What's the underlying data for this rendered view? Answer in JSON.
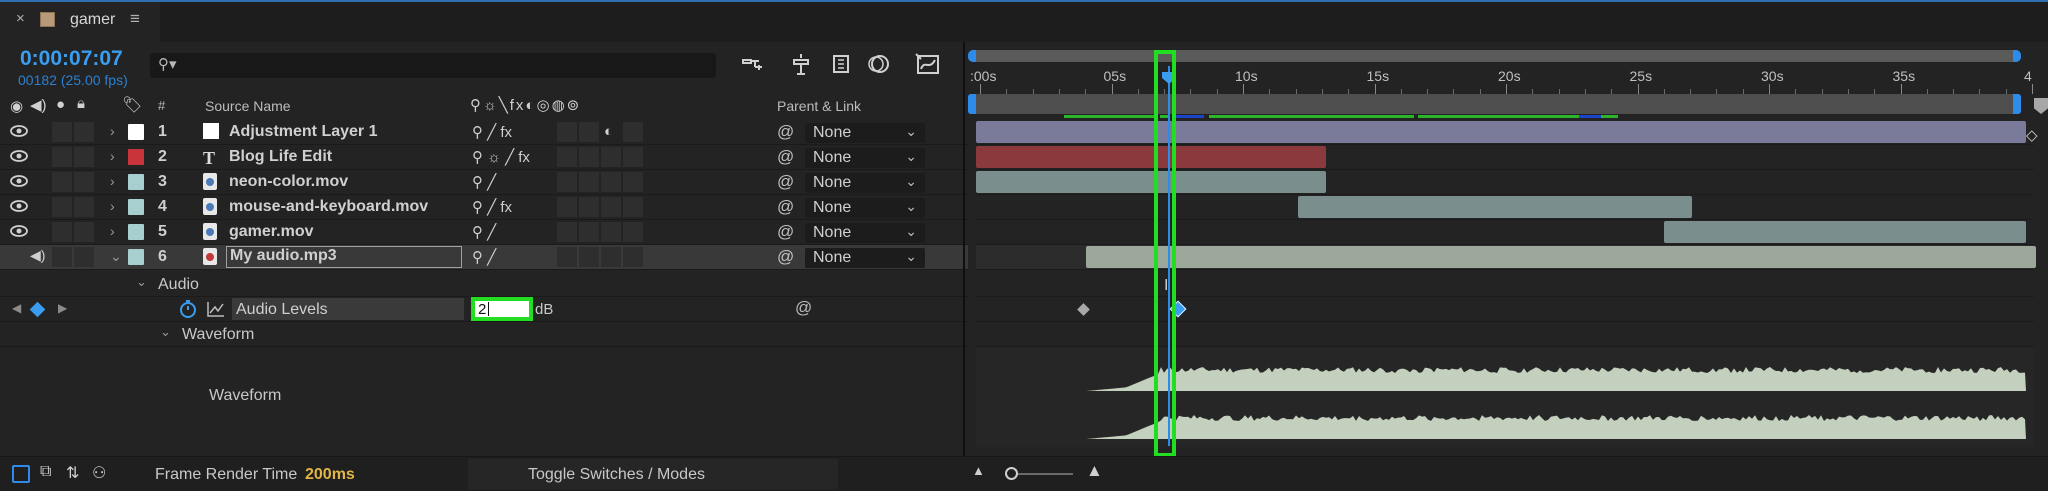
{
  "tab": {
    "title": "gamer"
  },
  "timecode": {
    "main": "0:00:07:07",
    "sub": "00182 (25.00 fps)"
  },
  "search": {
    "placeholder": ""
  },
  "columns": {
    "num": "#",
    "source_name": "Source Name",
    "parent_link": "Parent & Link"
  },
  "layers": [
    {
      "num": "1",
      "name": "Adjustment Layer 1",
      "label_color": "#ffffff",
      "type": "adjustment",
      "parent": "None",
      "switches": "⚲ ╱ fx"
    },
    {
      "num": "2",
      "name": "Blog Life Edit",
      "label_color": "#c8343a",
      "type": "text",
      "parent": "None",
      "switches": "⚲ ☼ ╱ fx"
    },
    {
      "num": "3",
      "name": "neon-color.mov",
      "label_color": "#a8cfcf",
      "type": "footage",
      "parent": "None",
      "switches": "⚲ ╱"
    },
    {
      "num": "4",
      "name": "mouse-and-keyboard.mov",
      "label_color": "#a8cfcf",
      "type": "footage",
      "parent": "None",
      "switches": "⚲ ╱ fx"
    },
    {
      "num": "5",
      "name": "gamer.mov",
      "label_color": "#a8cfcf",
      "type": "footage",
      "parent": "None",
      "switches": "⚲ ╱"
    },
    {
      "num": "6",
      "name": "My audio.mp3",
      "label_color": "#a8cfcf",
      "type": "audio",
      "parent": "None",
      "switches": "⚲ ╱"
    }
  ],
  "audio_group": {
    "label": "Audio"
  },
  "audio_levels": {
    "label": "Audio Levels",
    "value": "2",
    "unit": "dB"
  },
  "waveform_group": {
    "label": "Waveform"
  },
  "waveform_label": "Waveform",
  "ruler": {
    "ticks": [
      ":00s",
      "05s",
      "10s",
      "15s",
      "20s",
      "25s",
      "30s",
      "35s",
      "4"
    ]
  },
  "bottom": {
    "frame_render_label": "Frame Render Time",
    "frame_render_value": "200ms",
    "toggle_label": "Toggle Switches / Modes"
  },
  "colors": {
    "accent_blue": "#2d8ceb",
    "highlight_green": "#22dd22",
    "adjustment_bar": "#7a7a9a",
    "text_bar": "#8a3a3c",
    "footage_bar": "#7a8e8e",
    "audio_bar": "#9ba89a",
    "waveform": "#c4d0be"
  }
}
